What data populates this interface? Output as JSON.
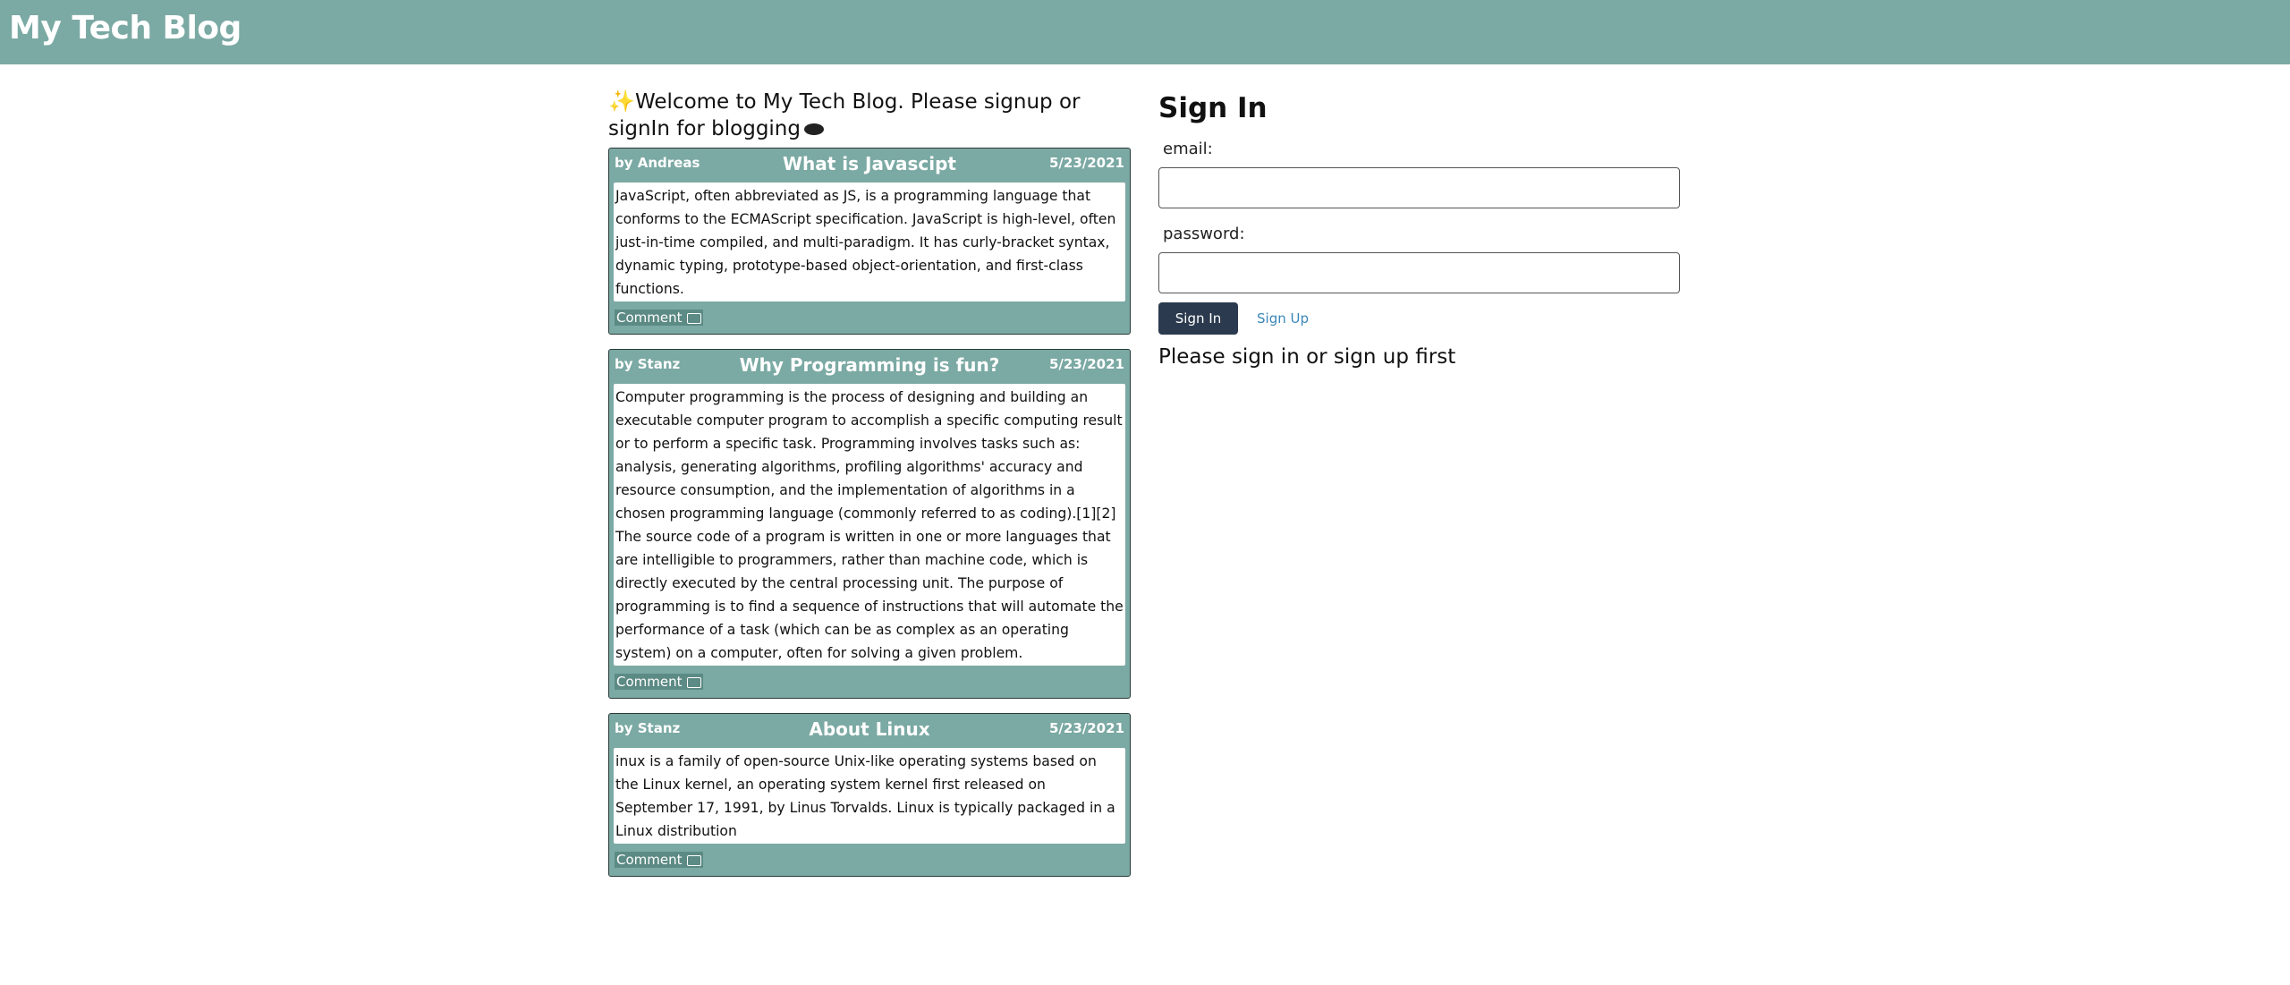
{
  "header": {
    "title": "My Tech Blog"
  },
  "welcome": {
    "text": "Welcome to My Tech Blog. Please signup or signIn for blogging"
  },
  "posts": [
    {
      "author": "by Andreas",
      "title": "What is Javascipt",
      "date": "5/23/2021",
      "body": "JavaScript, often abbreviated as JS, is a programming language that conforms to the ECMAScript specification. JavaScript is high-level, often just-in-time compiled, and multi-paradigm. It has curly-bracket syntax, dynamic typing, prototype-based object-orientation, and first-class functions.",
      "comment_label": "Comment"
    },
    {
      "author": "by Stanz",
      "title": "Why Programming is fun?",
      "date": "5/23/2021",
      "body": "Computer programming is the process of designing and building an executable computer program to accomplish a specific computing result or to perform a specific task. Programming involves tasks such as: analysis, generating algorithms, profiling algorithms' accuracy and resource consumption, and the implementation of algorithms in a chosen programming language (commonly referred to as coding).[1][2] The source code of a program is written in one or more languages that are intelligible to programmers, rather than machine code, which is directly executed by the central processing unit. The purpose of programming is to find a sequence of instructions that will automate the performance of a task (which can be as complex as an operating system) on a computer, often for solving a given problem.",
      "comment_label": "Comment"
    },
    {
      "author": "by Stanz",
      "title": "About Linux",
      "date": "5/23/2021",
      "body": "inux is a family of open-source Unix-like operating systems based on the Linux kernel, an operating system kernel first released on September 17, 1991, by Linus Torvalds. Linux is typically packaged in a Linux distribution",
      "comment_label": "Comment"
    }
  ],
  "signin": {
    "title": "Sign In",
    "email_label": "email:",
    "email_value": "",
    "password_label": "password:",
    "password_value": "",
    "signin_button": "Sign In",
    "signup_button": "Sign Up",
    "notice": "Please sign in or sign up first"
  },
  "colors": {
    "header_bg": "#7ba9a3",
    "post_bg": "#7ba9a3",
    "signin_button_bg": "#2b3a4e",
    "signup_link": "#3a86b8"
  },
  "icons": {
    "welcome_leading": "sparkles-icon",
    "welcome_trailing": "speech-bubble-icon",
    "comment": "comment-icon"
  }
}
